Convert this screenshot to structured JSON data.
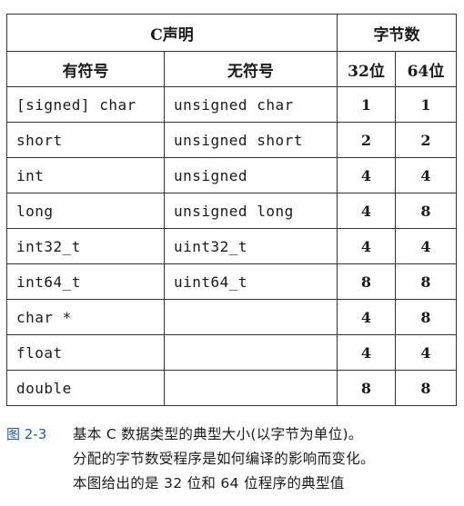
{
  "table": {
    "header": {
      "group_c_decl": "C声明",
      "group_bytes": "字节数",
      "signed": "有符号",
      "unsigned": "无符号",
      "bits32": "32位",
      "bits64": "64位"
    },
    "rows": [
      {
        "signed": "[signed] char",
        "unsigned": "unsigned char",
        "b32": "1",
        "b64": "1"
      },
      {
        "signed": "short",
        "unsigned": "unsigned short",
        "b32": "2",
        "b64": "2"
      },
      {
        "signed": "int",
        "unsigned": "unsigned",
        "b32": "4",
        "b64": "4"
      },
      {
        "signed": "long",
        "unsigned": "unsigned long",
        "b32": "4",
        "b64": "8"
      },
      {
        "signed": "int32_t",
        "unsigned": "uint32_t",
        "b32": "4",
        "b64": "4"
      },
      {
        "signed": "int64_t",
        "unsigned": "uint64_t",
        "b32": "8",
        "b64": "8"
      },
      {
        "signed": "char *",
        "unsigned": "",
        "b32": "4",
        "b64": "8"
      },
      {
        "signed": "float",
        "unsigned": "",
        "b32": "4",
        "b64": "4"
      },
      {
        "signed": "double",
        "unsigned": "",
        "b32": "8",
        "b64": "8"
      }
    ]
  },
  "caption": {
    "label": "图 2-3",
    "line1": "基本 C 数据类型的典型大小(以字节为单位)。",
    "line2": "分配的字节数受程序是如何编译的影响而变化。",
    "line3": "本图给出的是 32 位和 64 位程序的典型值"
  },
  "colors": {
    "caption_label": "#1f5aa6",
    "border": "#333333"
  }
}
